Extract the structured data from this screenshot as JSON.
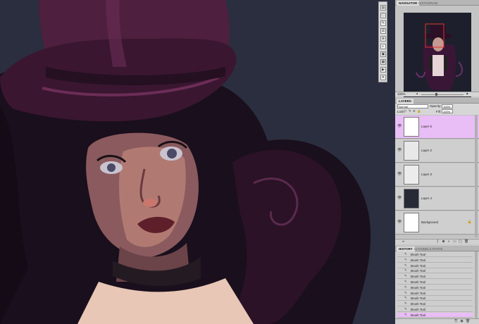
{
  "tools": [
    {
      "icon": "histogram-icon",
      "glyph": "▤"
    },
    {
      "icon": "info-icon",
      "glyph": "ⓘ"
    },
    {
      "icon": "brush-icon",
      "glyph": "✎"
    },
    {
      "icon": "layer-comps-icon",
      "glyph": "☰"
    },
    {
      "icon": "clone-source-icon",
      "glyph": "⊕"
    },
    {
      "icon": "adjustments-icon",
      "glyph": "◐"
    },
    {
      "icon": "masks-icon",
      "glyph": "▣"
    },
    {
      "icon": "swatches-icon",
      "glyph": "▦"
    },
    {
      "icon": "actions-icon",
      "glyph": "▶"
    },
    {
      "icon": "styles-icon",
      "glyph": "✦"
    }
  ],
  "navigator": {
    "tabs": [
      "NAVIGATOR",
      "HISTOGRAM"
    ],
    "zoom": "100%"
  },
  "layers": {
    "tab": "LAYERS",
    "blend_mode": "Normal",
    "opacity_label": "Opacity:",
    "opacity": "100%",
    "lock_label": "Lock:",
    "fill_label": "Fill:",
    "fill": "100%",
    "items": [
      {
        "name": "Layer 5",
        "selected": true
      },
      {
        "name": "Layer 2",
        "selected": false
      },
      {
        "name": "Layer 3",
        "selected": false
      },
      {
        "name": "Layer 4",
        "selected": false
      },
      {
        "name": "Background",
        "selected": false,
        "locked": true
      }
    ]
  },
  "history": {
    "tabs": [
      "HISTORY",
      "CHANNELS",
      "PATHS"
    ],
    "items": [
      "Brush Tool",
      "Brush Tool",
      "Brush Tool",
      "Brush Tool",
      "Brush Tool",
      "Brush Tool",
      "Brush Tool",
      "Brush Tool",
      "Brush Tool",
      "Brush Tool",
      "Brush Tool",
      "Brush Tool"
    ],
    "selected_index": 11
  },
  "colors": {
    "canvas_bg": "#2a2e3e",
    "selection": "#e9bdf6",
    "panel_bg": "#c8c8c8"
  }
}
